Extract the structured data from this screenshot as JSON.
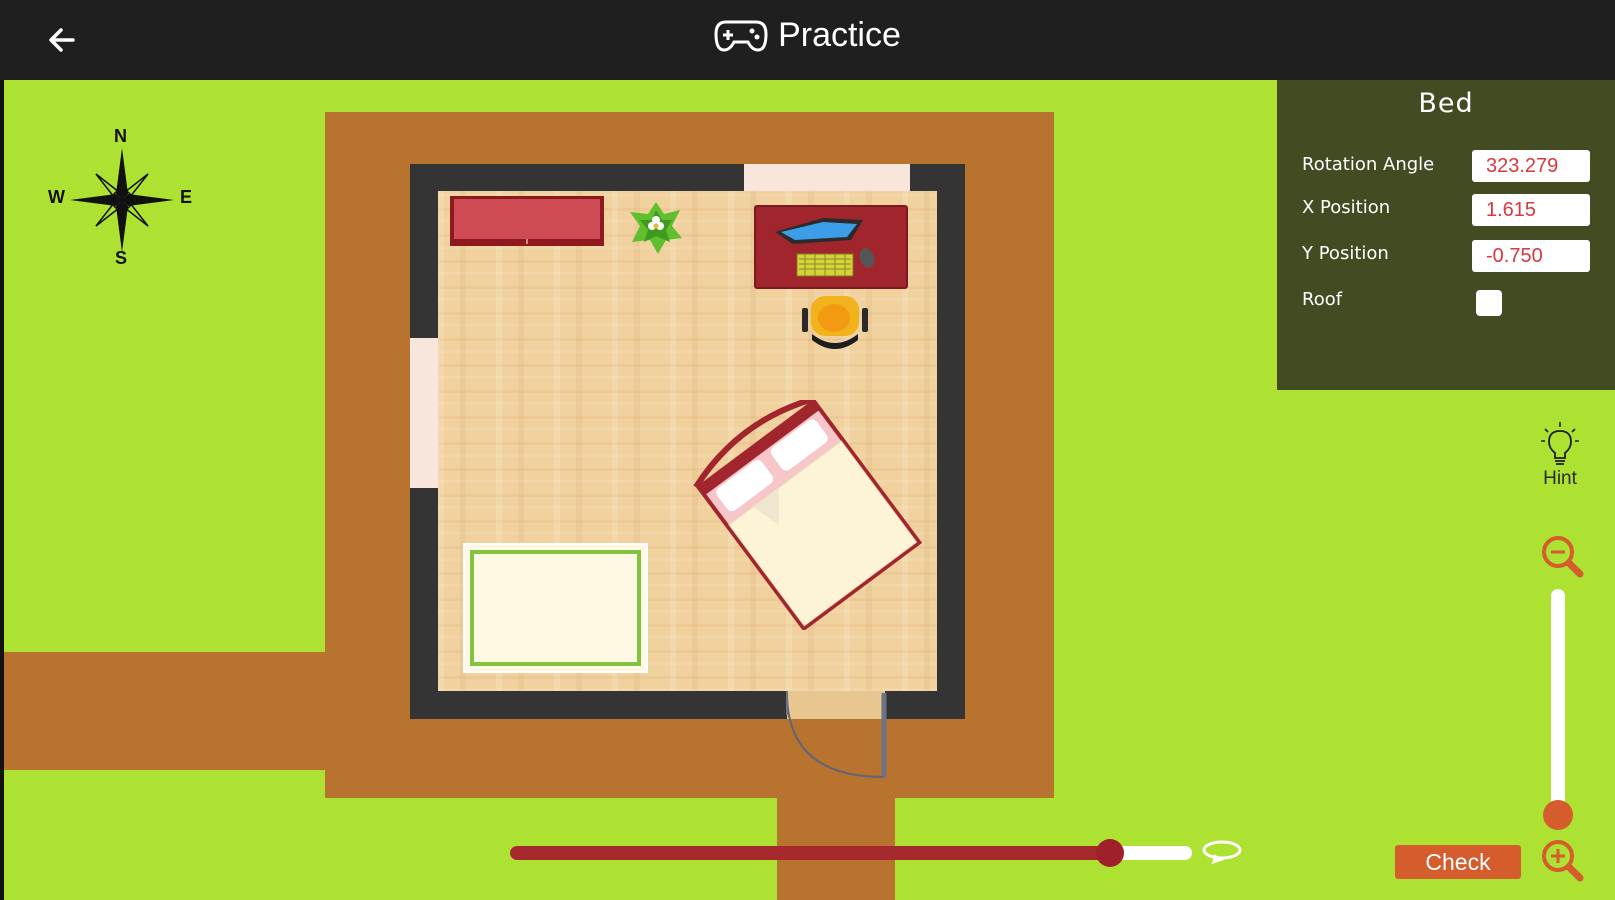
{
  "header": {
    "title": "Practice",
    "back_icon": "arrow-left-icon",
    "title_icon": "gamepad-icon"
  },
  "compass": {
    "north": "N",
    "south": "S",
    "east": "E",
    "west": "W"
  },
  "panel": {
    "title": "Bed",
    "rotation_label": "Rotation Angle",
    "rotation_value": "323.279",
    "x_label": "X Position",
    "x_value": "1.615",
    "y_label": "Y Position",
    "y_value": "-0.750",
    "roof_label": "Roof",
    "roof_checked": false
  },
  "hint": {
    "label": "Hint",
    "icon": "lightbulb-icon"
  },
  "check": {
    "label": "Check"
  },
  "rotation_slider": {
    "value_fraction": 0.88,
    "icon": "rotate-icon"
  },
  "zoom": {
    "minus_icon": "zoom-out-icon",
    "plus_icon": "zoom-in-icon",
    "value_fraction": 1.0
  },
  "colors": {
    "grass": "#ade132",
    "path": "#b8732f",
    "wall": "#343434",
    "panel": "#434b22",
    "accent_red": "#a6292d",
    "accent_orange": "#d55c2c"
  }
}
